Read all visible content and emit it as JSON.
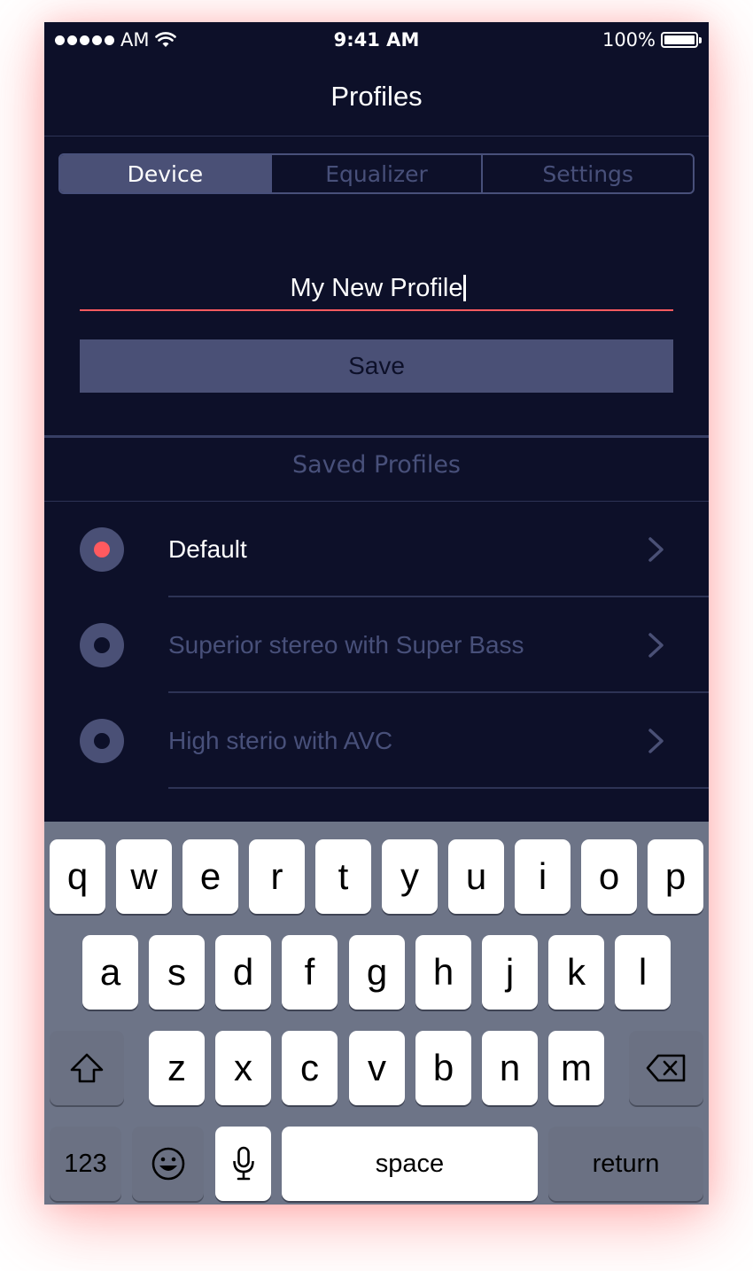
{
  "status_bar": {
    "carrier": "AM",
    "time": "9:41 AM",
    "battery": "100%"
  },
  "nav": {
    "title": "Profiles"
  },
  "tabs": [
    {
      "label": "Device",
      "active": true
    },
    {
      "label": "Equalizer",
      "active": false
    },
    {
      "label": "Settings",
      "active": false
    }
  ],
  "profile_form": {
    "name_value": "My New Profile",
    "save_label": "Save"
  },
  "saved_profiles": {
    "heading": "Saved Profiles",
    "items": [
      {
        "label": "Default",
        "selected": true
      },
      {
        "label": "Superior stereo with Super Bass",
        "selected": false
      },
      {
        "label": "High sterio with AVC",
        "selected": false
      }
    ]
  },
  "keyboard": {
    "row1": [
      "q",
      "w",
      "e",
      "r",
      "t",
      "y",
      "u",
      "i",
      "o",
      "p"
    ],
    "row2": [
      "a",
      "s",
      "d",
      "f",
      "g",
      "h",
      "j",
      "k",
      "l"
    ],
    "row3": [
      "z",
      "x",
      "c",
      "v",
      "b",
      "n",
      "m"
    ],
    "numbers_label": "123",
    "space_label": "space",
    "return_label": "return"
  },
  "colors": {
    "background": "#0d1029",
    "accent": "#ff5a5f",
    "muted": "#4a5076"
  }
}
